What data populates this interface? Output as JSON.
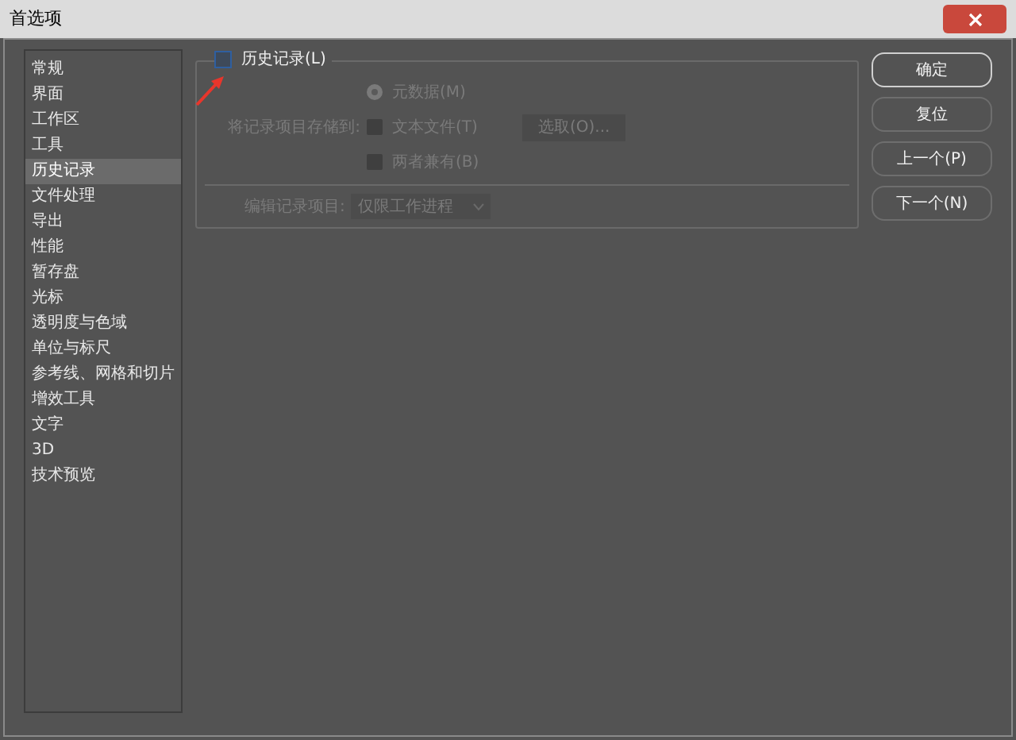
{
  "window": {
    "title": "首选项"
  },
  "sidebar": {
    "items": [
      {
        "label": "常规",
        "selected": false
      },
      {
        "label": "界面",
        "selected": false
      },
      {
        "label": "工作区",
        "selected": false
      },
      {
        "label": "工具",
        "selected": false
      },
      {
        "label": "历史记录",
        "selected": true
      },
      {
        "label": "文件处理",
        "selected": false
      },
      {
        "label": "导出",
        "selected": false
      },
      {
        "label": "性能",
        "selected": false
      },
      {
        "label": "暂存盘",
        "selected": false
      },
      {
        "label": "光标",
        "selected": false
      },
      {
        "label": "透明度与色域",
        "selected": false
      },
      {
        "label": "单位与标尺",
        "selected": false
      },
      {
        "label": "参考线、网格和切片",
        "selected": false
      },
      {
        "label": "增效工具",
        "selected": false
      },
      {
        "label": "文字",
        "selected": false
      },
      {
        "label": "3D",
        "selected": false
      },
      {
        "label": "技术预览",
        "selected": false
      }
    ]
  },
  "history": {
    "label": "历史记录(L)",
    "checked": false,
    "save_to_label": "将记录项目存储到:",
    "options": [
      {
        "kind": "radio",
        "label": "元数据(M)",
        "selected": true,
        "disabled": true
      },
      {
        "kind": "checkbox",
        "label": "文本文件(T)",
        "selected": false,
        "disabled": true,
        "button": "选取(O)..."
      },
      {
        "kind": "checkbox",
        "label": "两者兼有(B)",
        "selected": false,
        "disabled": true
      }
    ],
    "edit_log_label": "编辑记录项目:",
    "edit_log_value": "仅限工作进程",
    "edit_log_disabled": true
  },
  "buttons": [
    {
      "label": "确定",
      "default": true
    },
    {
      "label": "复位",
      "default": false
    },
    {
      "label": "上一个(P)",
      "default": false
    },
    {
      "label": "下一个(N)",
      "default": false
    }
  ]
}
